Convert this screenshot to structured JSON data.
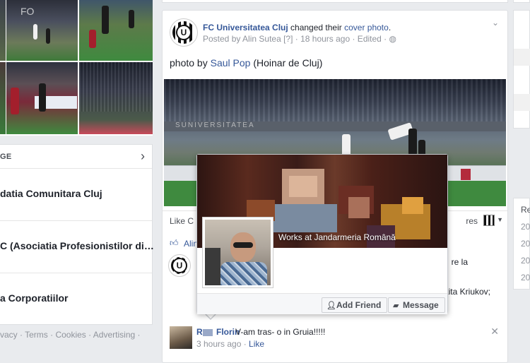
{
  "left": {
    "photo_watermark": "FO",
    "pages_header": "GE",
    "pages": [
      "datia Comunitara Cluj",
      "C (Asociatia Profesionistilor di…",
      "a Corporatiilor"
    ],
    "footer": "vacy · Terms · Cookies · Advertising ·"
  },
  "post": {
    "author": "FC Universitatea Cluj",
    "action_prefix": " changed their ",
    "action_link": "cover photo",
    "action_suffix": ".",
    "posted_by_prefix": "Posted by ",
    "posted_by": "Alin Sutea",
    "meta_rest": " [?] · 18 hours ago · Edited · ",
    "text_prefix": "photo by ",
    "text_link": "Saul Pop",
    "text_suffix": " (Hoinar de Cluj)",
    "photo_banner": "SUNIVERSITATEA",
    "like_label": "Like",
    "like_trail": " C",
    "shares_label": "res",
    "reaction_name": "Alin",
    "comment1_right": "re la",
    "comment1_right2": "kita Kriukov;",
    "comment2": {
      "name_prefix": "R",
      "name": "Florin",
      "text": "V-am tras- o in Gruia!!!!!",
      "time": "3 hours ago · ",
      "like": "Like"
    }
  },
  "hovercard": {
    "work": "Works at Jandarmeria Română",
    "add_friend": "Add Friend",
    "message": "Message"
  },
  "right": {
    "label_re": "Re",
    "years": [
      "20",
      "20",
      "20",
      "20"
    ]
  },
  "colors": {
    "link": "#365899",
    "bg": "#e9ebee",
    "meta": "#90949c"
  }
}
